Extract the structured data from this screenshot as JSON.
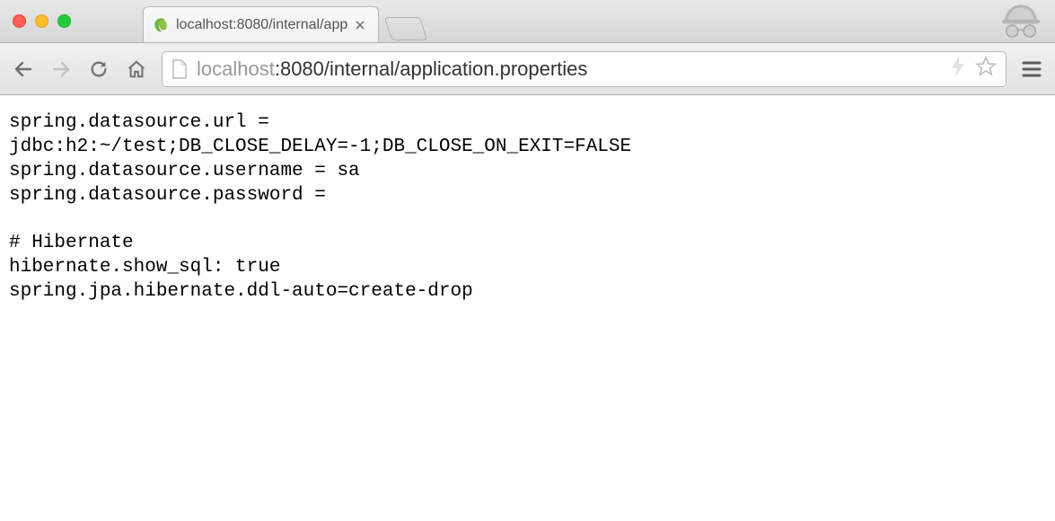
{
  "window": {
    "tab_title": "localhost:8080/internal/app",
    "favicon": "leaf-icon"
  },
  "toolbar": {
    "url_host": "localhost",
    "url_rest": ":8080/internal/application.properties"
  },
  "content": {
    "body": "spring.datasource.url =\njdbc:h2:~/test;DB_CLOSE_DELAY=-1;DB_CLOSE_ON_EXIT=FALSE\nspring.datasource.username = sa\nspring.datasource.password =\n\n# Hibernate\nhibernate.show_sql: true\nspring.jpa.hibernate.ddl-auto=create-drop"
  }
}
